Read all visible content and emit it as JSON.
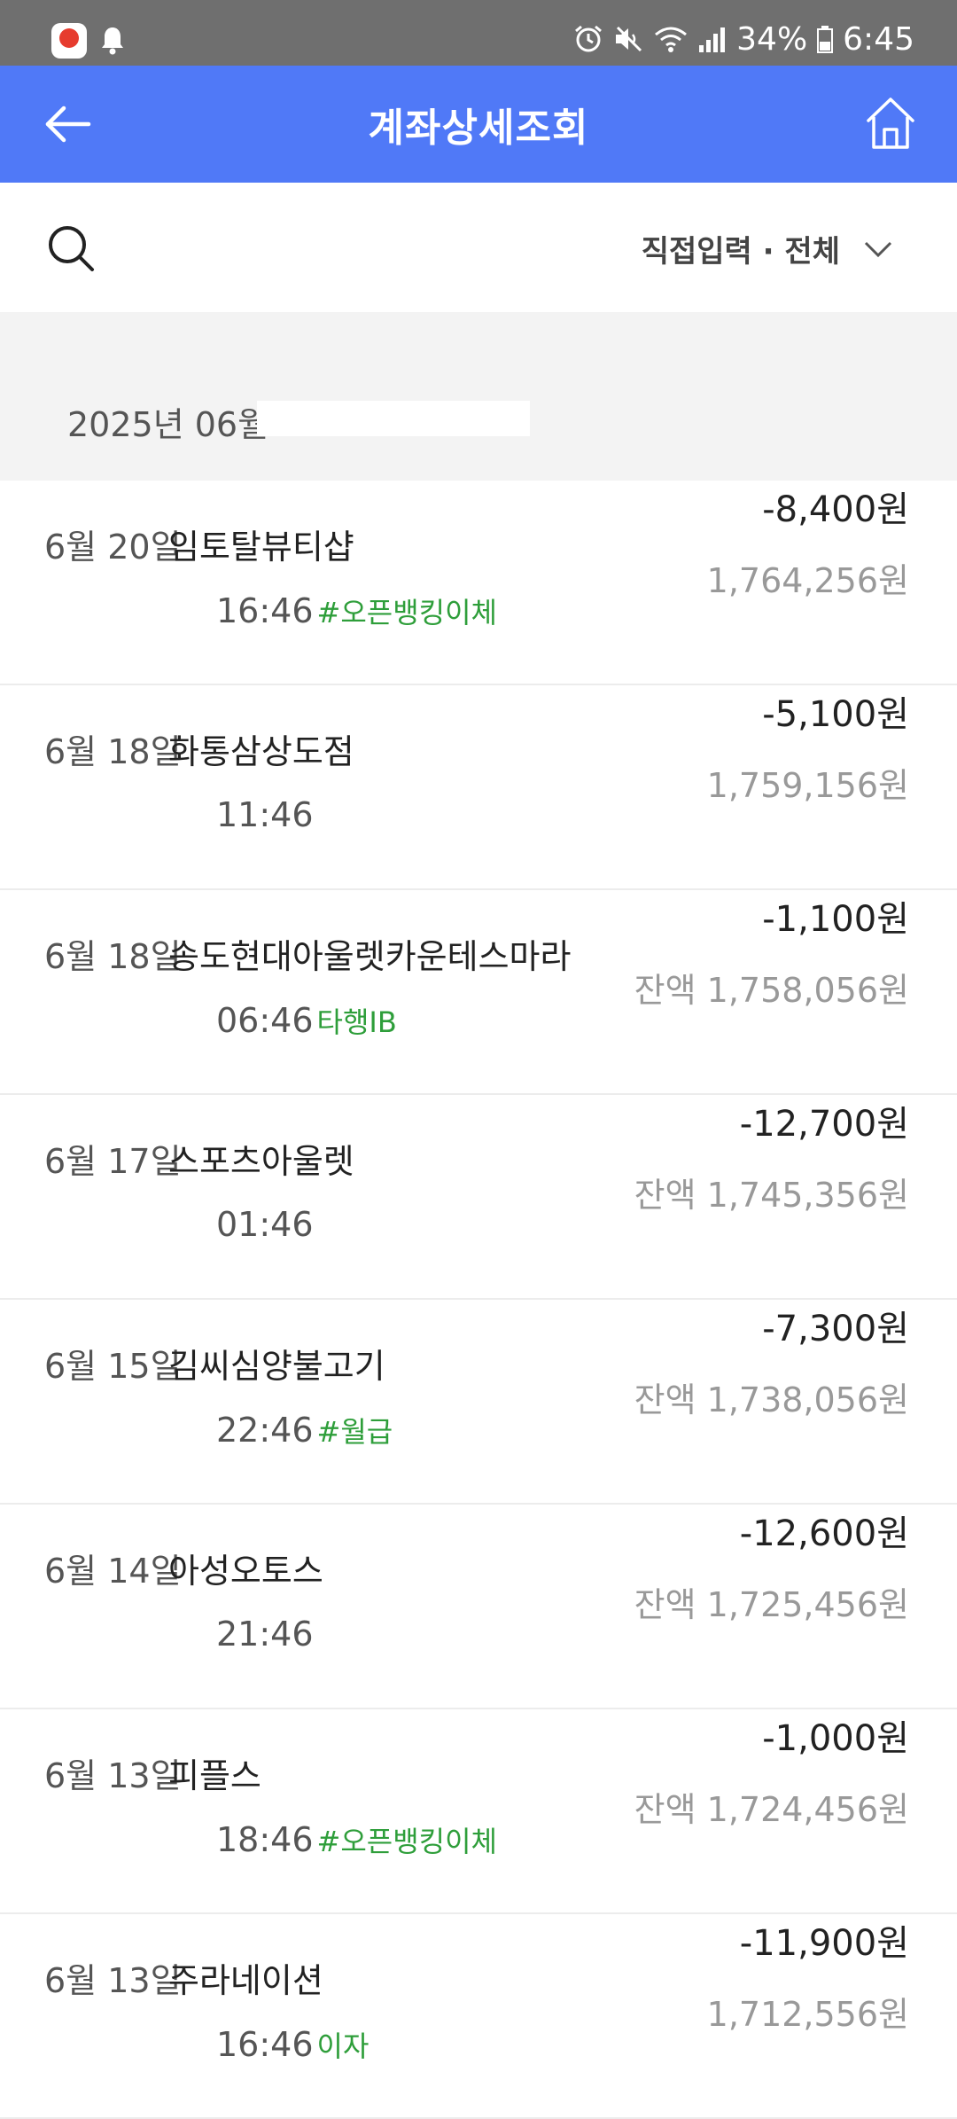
{
  "status_bar": {
    "battery": "34%",
    "time": "6:45"
  },
  "header": {
    "title": "계좌상세조회"
  },
  "filter": {
    "selected": "직접입력 · 전체"
  },
  "month": {
    "label": "2025년 06월"
  },
  "transactions": [
    {
      "date": "6월 20일",
      "merchant": "임토탈뷰티샵",
      "time": "16:46",
      "tag": "#오픈뱅킹이체",
      "amount": "-8,400원",
      "balance": "1,764,256원"
    },
    {
      "date": "6월 18일",
      "merchant": "화통삼상도점",
      "time": "11:46",
      "tag": "",
      "amount": "-5,100원",
      "balance": "1,759,156원"
    },
    {
      "date": "6월 18일",
      "merchant": "송도현대아울렛카운테스마라",
      "time": "06:46",
      "tag": "타행IB",
      "amount": "-1,100원",
      "balance": "잔액 1,758,056원"
    },
    {
      "date": "6월 17일",
      "merchant": "스포츠아울렛",
      "time": "01:46",
      "tag": "",
      "amount": "-12,700원",
      "balance": "잔액 1,745,356원"
    },
    {
      "date": "6월 15일",
      "merchant": "김씨심양불고기",
      "time": "22:46",
      "tag": "#월급",
      "amount": "-7,300원",
      "balance": "잔액 1,738,056원"
    },
    {
      "date": "6월 14일",
      "merchant": "아성오토스",
      "time": "21:46",
      "tag": "",
      "amount": "-12,600원",
      "balance": "잔액 1,725,456원"
    },
    {
      "date": "6월 13일",
      "merchant": "피플스",
      "time": "18:46",
      "tag": "#오픈뱅킹이체",
      "amount": "-1,000원",
      "balance": "잔액 1,724,456원"
    },
    {
      "date": "6월 13일",
      "merchant": "주라네이션",
      "time": "16:46",
      "tag": "이자",
      "amount": "-11,900원",
      "balance": "1,712,556원"
    }
  ]
}
